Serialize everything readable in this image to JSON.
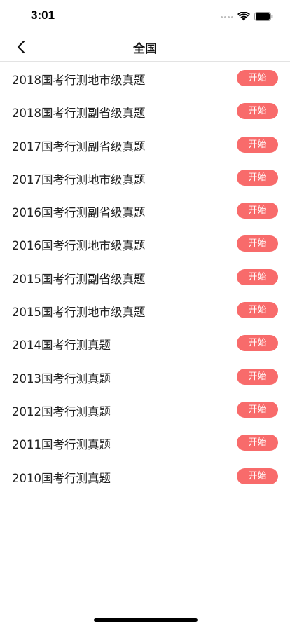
{
  "status": {
    "time": "3:01"
  },
  "nav": {
    "title": "全国"
  },
  "colors": {
    "accent": "#f86b6b"
  },
  "items": [
    {
      "title": "2018国考行测地市级真题",
      "action": "开始"
    },
    {
      "title": "2018国考行测副省级真题",
      "action": "开始"
    },
    {
      "title": "2017国考行测副省级真题",
      "action": "开始"
    },
    {
      "title": "2017国考行测地市级真题",
      "action": "开始"
    },
    {
      "title": "2016国考行测副省级真题",
      "action": "开始"
    },
    {
      "title": "2016国考行测地市级真题",
      "action": "开始"
    },
    {
      "title": "2015国考行测副省级真题",
      "action": "开始"
    },
    {
      "title": "2015国考行测地市级真题",
      "action": "开始"
    },
    {
      "title": "2014国考行测真题",
      "action": "开始"
    },
    {
      "title": "2013国考行测真题",
      "action": "开始"
    },
    {
      "title": "2012国考行测真题",
      "action": "开始"
    },
    {
      "title": "2011国考行测真题",
      "action": "开始"
    },
    {
      "title": "2010国考行测真题",
      "action": "开始"
    }
  ]
}
